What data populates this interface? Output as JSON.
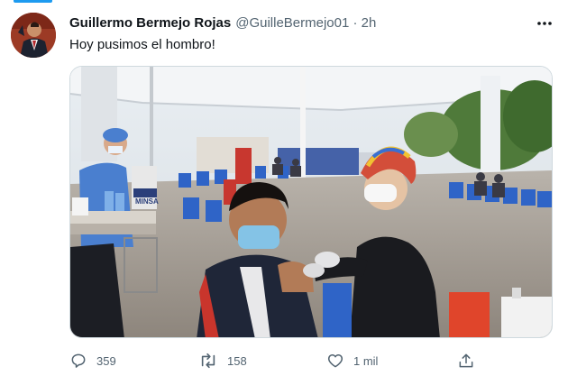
{
  "tweet": {
    "author_name": "Guillermo Bermejo Rojas",
    "author_handle": "@GuilleBermejo01 · 2h",
    "text": "Hoy pusimos el hombro!",
    "media_sign_text": "MINSA",
    "more_icon": "more-horizontal-icon",
    "actions": {
      "reply_count": "359",
      "retweet_count": "158",
      "like_count": "1 mil",
      "reply_icon": "reply-icon",
      "retweet_icon": "retweet-icon",
      "like_icon": "heart-icon",
      "share_icon": "share-icon"
    }
  },
  "colors": {
    "accent": "#1d9bf0",
    "secondary_text": "#536471",
    "primary_text": "#0f1419",
    "border": "#cfd9de"
  }
}
